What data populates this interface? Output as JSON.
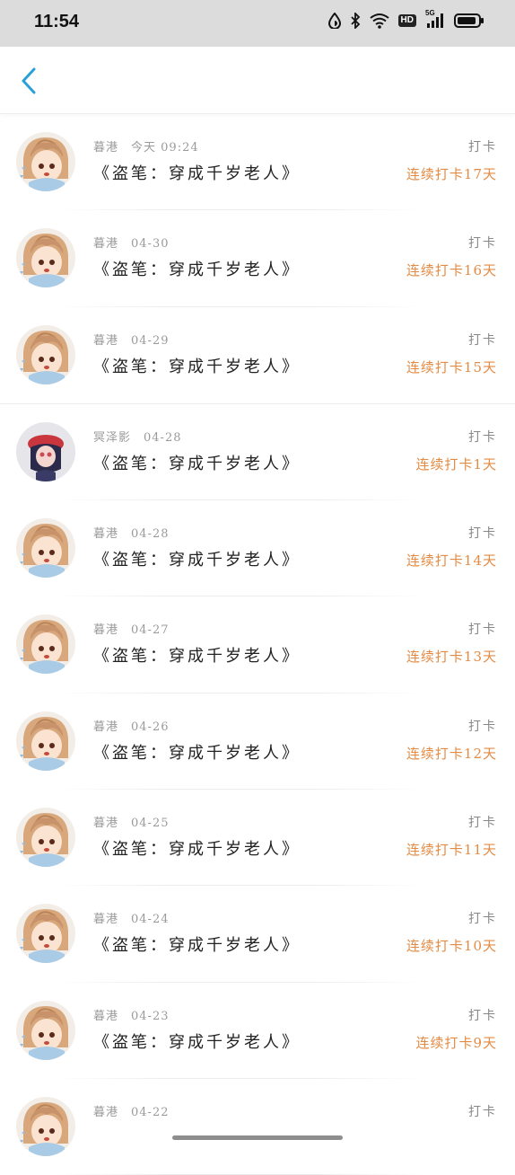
{
  "status": {
    "time": "11:54",
    "hd": "HD",
    "network": "5G"
  },
  "colors": {
    "accent": "#2aa0d8",
    "streak": "#e38b44"
  },
  "items": [
    {
      "user": "暮港",
      "date": "今天 09:24",
      "book": "《盗笔：穿成千岁老人》",
      "tag": "打卡",
      "streak": "连续打卡17天",
      "avatar": "anime-girl-avatar"
    },
    {
      "user": "暮港",
      "date": "04-30",
      "book": "《盗笔：穿成千岁老人》",
      "tag": "打卡",
      "streak": "连续打卡16天",
      "avatar": "anime-girl-avatar"
    },
    {
      "user": "暮港",
      "date": "04-29",
      "book": "《盗笔：穿成千岁老人》",
      "tag": "打卡",
      "streak": "连续打卡15天",
      "avatar": "anime-girl-avatar"
    },
    {
      "user": "冥泽影",
      "date": "04-28",
      "book": "《盗笔：穿成千岁老人》",
      "tag": "打卡",
      "streak": "连续打卡1天",
      "avatar": "red-beret-avatar"
    },
    {
      "user": "暮港",
      "date": "04-28",
      "book": "《盗笔：穿成千岁老人》",
      "tag": "打卡",
      "streak": "连续打卡14天",
      "avatar": "anime-girl-avatar"
    },
    {
      "user": "暮港",
      "date": "04-27",
      "book": "《盗笔：穿成千岁老人》",
      "tag": "打卡",
      "streak": "连续打卡13天",
      "avatar": "anime-girl-avatar"
    },
    {
      "user": "暮港",
      "date": "04-26",
      "book": "《盗笔：穿成千岁老人》",
      "tag": "打卡",
      "streak": "连续打卡12天",
      "avatar": "anime-girl-avatar"
    },
    {
      "user": "暮港",
      "date": "04-25",
      "book": "《盗笔：穿成千岁老人》",
      "tag": "打卡",
      "streak": "连续打卡11天",
      "avatar": "anime-girl-avatar"
    },
    {
      "user": "暮港",
      "date": "04-24",
      "book": "《盗笔：穿成千岁老人》",
      "tag": "打卡",
      "streak": "连续打卡10天",
      "avatar": "anime-girl-avatar"
    },
    {
      "user": "暮港",
      "date": "04-23",
      "book": "《盗笔：穿成千岁老人》",
      "tag": "打卡",
      "streak": "连续打卡9天",
      "avatar": "anime-girl-avatar"
    },
    {
      "user": "暮港",
      "date": "04-22",
      "book": "",
      "tag": "打卡",
      "streak": "",
      "avatar": "anime-girl-avatar"
    }
  ]
}
